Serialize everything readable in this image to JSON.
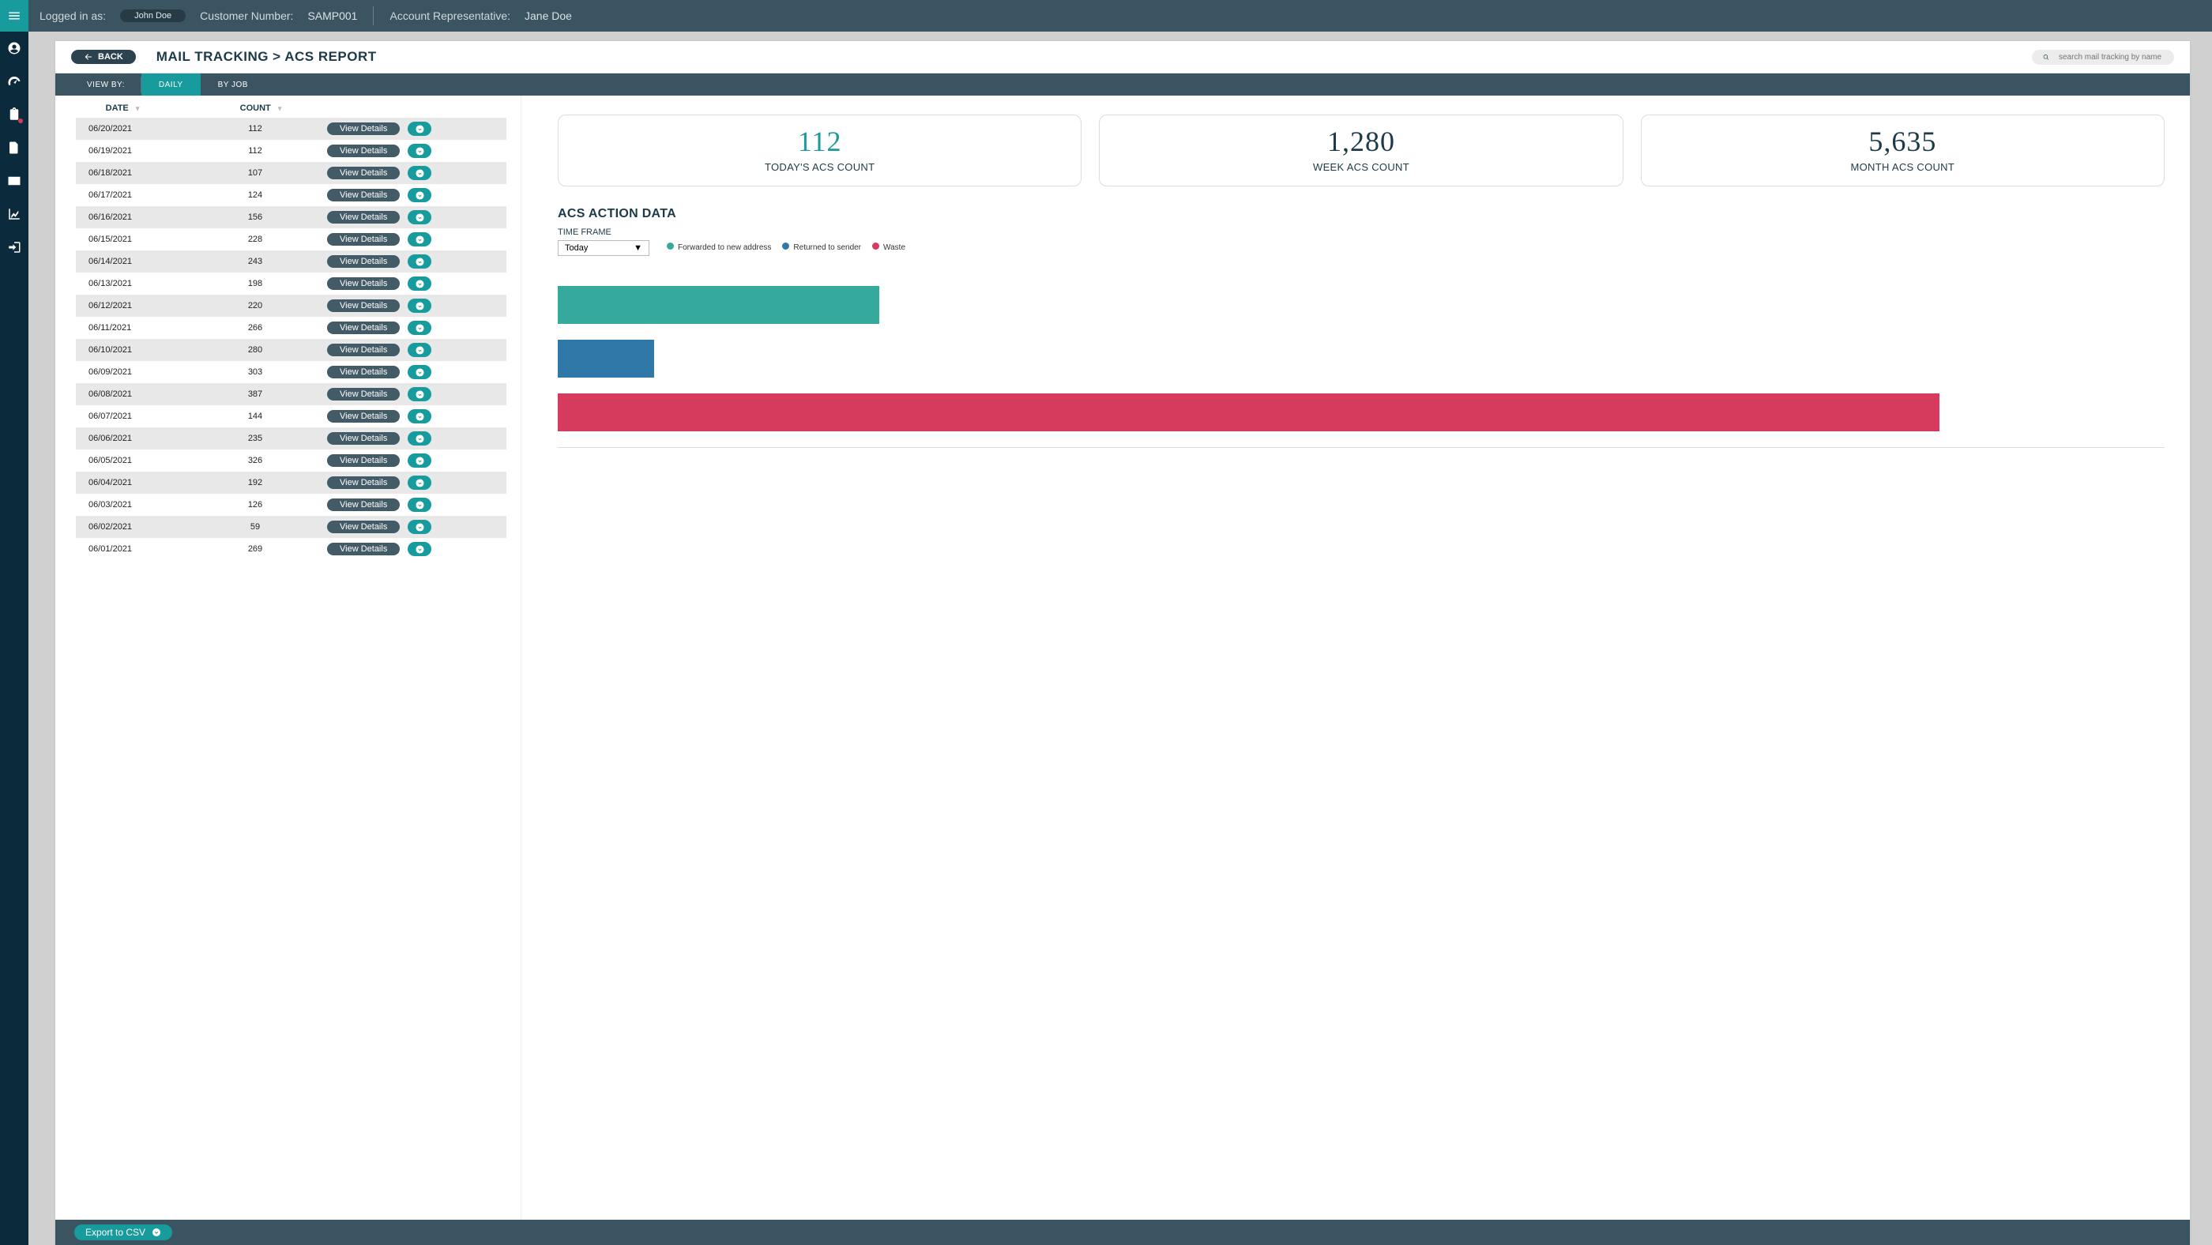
{
  "account_bar": {
    "logged_in_label": "Logged in as:",
    "logged_in_user": "John Doe",
    "customer_number_label": "Customer Number:",
    "customer_number": "SAMP001",
    "rep_label": "Account Representative:",
    "rep_name": "Jane Doe"
  },
  "header": {
    "back_label": "BACK",
    "title": "MAIL TRACKING > ACS REPORT",
    "search_placeholder": "search mail tracking by name or addre"
  },
  "tabs": {
    "view_by_label": "VIEW BY:",
    "daily": "DAILY",
    "by_job": "BY JOB"
  },
  "table": {
    "date_header": "DATE",
    "count_header": "COUNT",
    "view_details_label": "View Details",
    "rows": [
      {
        "date": "06/20/2021",
        "count": "112"
      },
      {
        "date": "06/19/2021",
        "count": "112"
      },
      {
        "date": "06/18/2021",
        "count": "107"
      },
      {
        "date": "06/17/2021",
        "count": "124"
      },
      {
        "date": "06/16/2021",
        "count": "156"
      },
      {
        "date": "06/15/2021",
        "count": "228"
      },
      {
        "date": "06/14/2021",
        "count": "243"
      },
      {
        "date": "06/13/2021",
        "count": "198"
      },
      {
        "date": "06/12/2021",
        "count": "220"
      },
      {
        "date": "06/11/2021",
        "count": "266"
      },
      {
        "date": "06/10/2021",
        "count": "280"
      },
      {
        "date": "06/09/2021",
        "count": "303"
      },
      {
        "date": "06/08/2021",
        "count": "387"
      },
      {
        "date": "06/07/2021",
        "count": "144"
      },
      {
        "date": "06/06/2021",
        "count": "235"
      },
      {
        "date": "06/05/2021",
        "count": "326"
      },
      {
        "date": "06/04/2021",
        "count": "192"
      },
      {
        "date": "06/03/2021",
        "count": "126"
      },
      {
        "date": "06/02/2021",
        "count": "59"
      },
      {
        "date": "06/01/2021",
        "count": "269"
      }
    ]
  },
  "stats": {
    "today_value": "112",
    "today_label": "TODAY'S ACS COUNT",
    "week_value": "1,280",
    "week_label": "WEEK ACS COUNT",
    "month_value": "5,635",
    "month_label": "MONTH ACS COUNT"
  },
  "action": {
    "title": "ACS ACTION DATA",
    "timeframe_label": "TIME FRAME",
    "timeframe_value": "Today",
    "legend_forwarded": "Forwarded to new address",
    "legend_returned": "Returned to sender",
    "legend_waste": "Waste"
  },
  "chart_data": {
    "type": "bar",
    "orientation": "horizontal",
    "categories": [
      "Forwarded to new address",
      "Returned to sender",
      "Waste"
    ],
    "values": [
      20,
      6,
      86
    ],
    "colors": [
      "#35a99b",
      "#2f78a8",
      "#d63b5e"
    ],
    "xlim": [
      0,
      100
    ]
  },
  "footer": {
    "export_label": "Export to CSV"
  },
  "sidebar": {
    "icons": [
      "menu-icon",
      "user-circle-icon",
      "gauge-icon",
      "clipboard-icon",
      "file-icon",
      "mail-icon",
      "chart-line-icon",
      "logout-icon"
    ]
  }
}
